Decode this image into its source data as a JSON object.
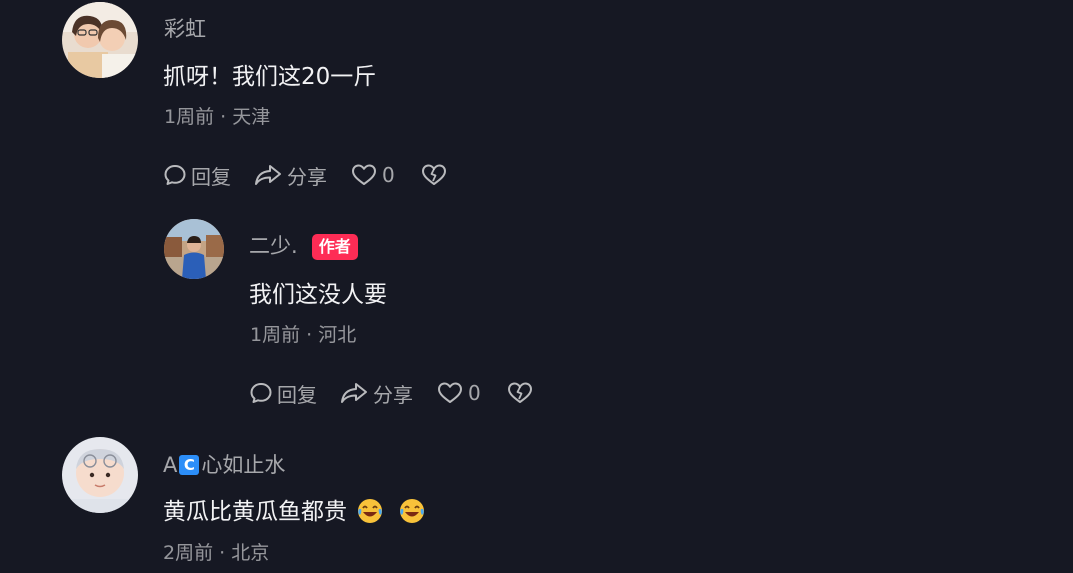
{
  "comments": [
    {
      "username": "彩虹",
      "text": "抓呀！我们这20一斤",
      "meta": "1周前 · 天津",
      "reply_label": "回复",
      "share_label": "分享",
      "like_count": "0",
      "avatar_icon": "two-girls-photo"
    },
    {
      "username": "二少.",
      "badge": "作者",
      "text": "我们这没人要",
      "meta": "1周前 · 河北",
      "reply_label": "回复",
      "share_label": "分享",
      "like_count": "0",
      "avatar_icon": "man-blue-jacket-photo"
    },
    {
      "username_prefix": "A",
      "username_badge_char": "C",
      "username_suffix": "心如止水",
      "text": "黄瓜比黄瓜鱼都贵",
      "meta": "2周前 · 北京",
      "avatar_icon": "baby-photo",
      "emojis": [
        "laughing-tears-emoji",
        "laughing-tears-emoji"
      ]
    }
  ],
  "colors": {
    "background": "#161823",
    "author_badge": "#fe2c55",
    "username_badge": "#2c8ef8"
  }
}
